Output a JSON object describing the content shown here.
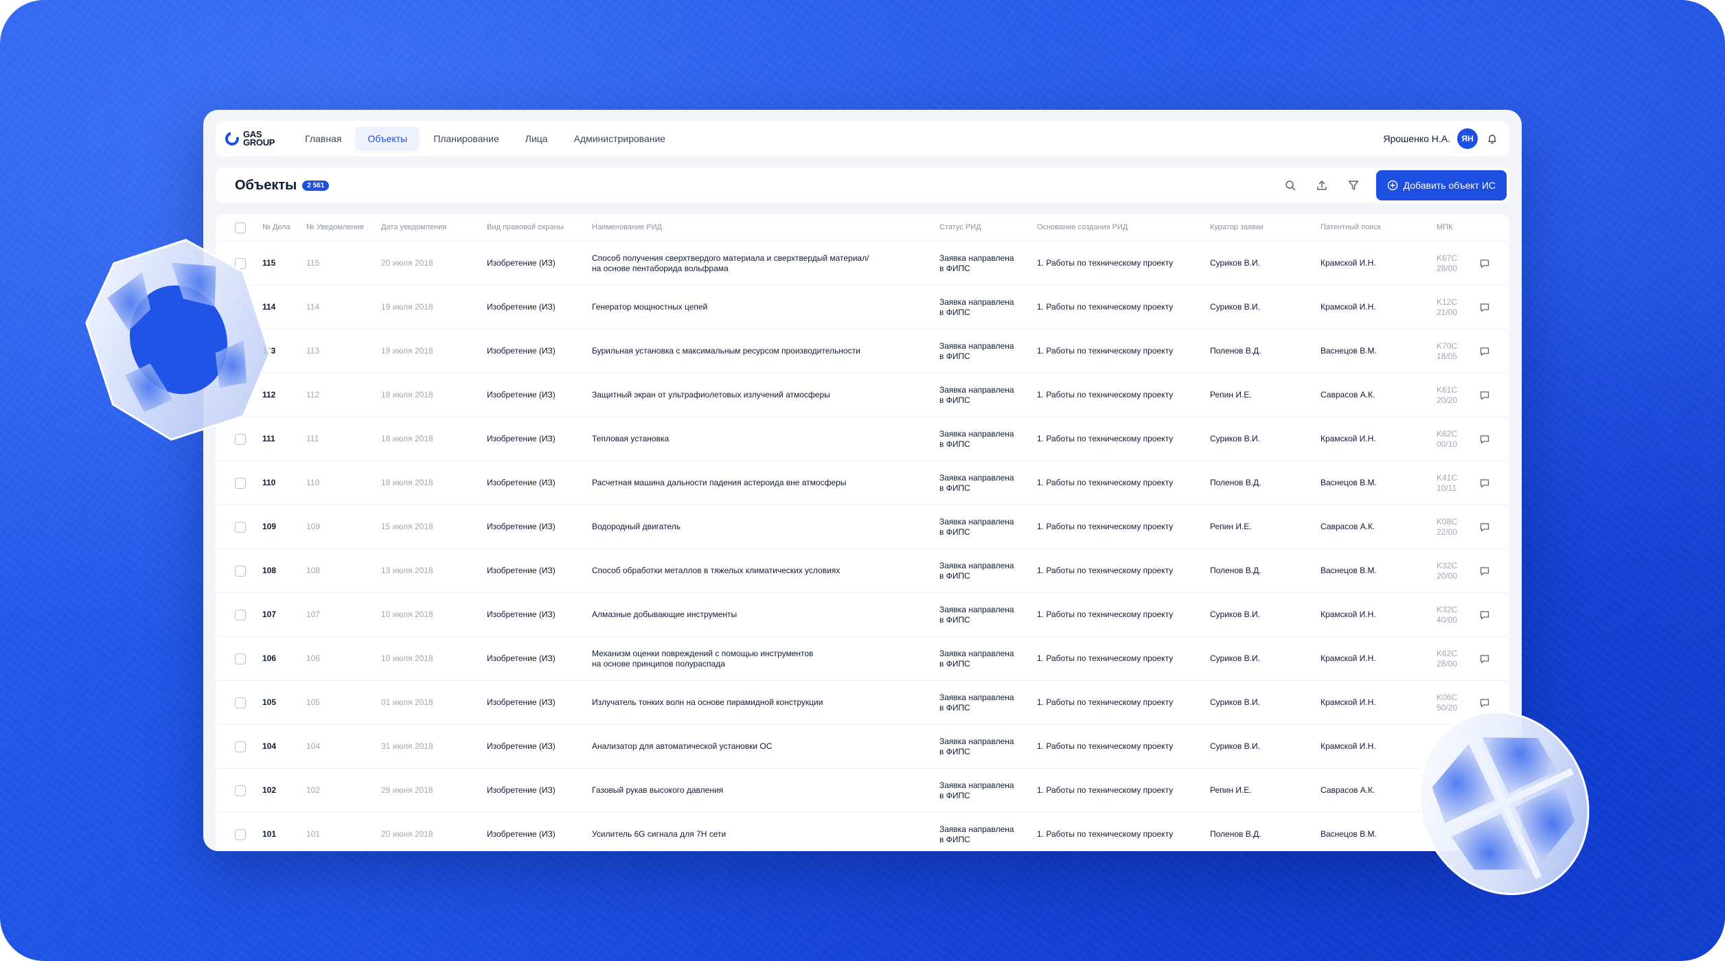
{
  "app": {
    "logo_line1": "GAS",
    "logo_line2": "GROUP"
  },
  "nav": {
    "tabs": [
      {
        "label": "Главная"
      },
      {
        "label": "Объекты"
      },
      {
        "label": "Планирование"
      },
      {
        "label": "Лица"
      },
      {
        "label": "Администрирование"
      }
    ],
    "active_tab": "Объекты",
    "user_name": "Ярошенко Н.А.",
    "avatar_initials": "ЯН",
    "bell_icon": "bell-icon"
  },
  "header": {
    "title": "Объекты",
    "count": "2 561",
    "add_button_label": "Добавить объект ИС",
    "icons": [
      "search-icon",
      "upload-icon",
      "filter-icon",
      "plus-circle-icon"
    ]
  },
  "table": {
    "columns": [
      "№ Дела",
      "№ Уведомления",
      "Дата уведомления",
      "Вид правовой охраны",
      "Наименование РИД",
      "Статус РИД",
      "Основание создания РИД",
      "Куратор заявки",
      "Патентный поиск",
      "МПК"
    ],
    "rows": [
      {
        "num": "115",
        "notif": "115",
        "date": "20 июля 2018",
        "type": "Изобретение (ИЗ)",
        "name1": "Способ получения сверхтвердого материала и сверхтвердый материал/",
        "name2": "на основе пентаборида вольфрама",
        "status1": "Заявка направлена",
        "status2": "в ФИПС",
        "basis": "1. Работы по техническому проекту",
        "curator": "Суриков В.И.",
        "patent": "Крамской И.Н.",
        "mpk1": "K67C",
        "mpk2": "28/00"
      },
      {
        "num": "114",
        "notif": "114",
        "date": "19 июля 2018",
        "type": "Изобретение (ИЗ)",
        "name1": "Генератор мощностных цепей",
        "name2": "",
        "status1": "Заявка направлена",
        "status2": "в ФИПС",
        "basis": "1. Работы по техническому проекту",
        "curator": "Суриков В.И.",
        "patent": "Крамской И.Н.",
        "mpk1": "K12C",
        "mpk2": "21/00"
      },
      {
        "num": "113",
        "notif": "113",
        "date": "19 июля 2018",
        "type": "Изобретение (ИЗ)",
        "name1": "Бурильная установка с максимальным ресурсом производительности",
        "name2": "",
        "status1": "Заявка направлена",
        "status2": "в ФИПС",
        "basis": "1. Работы по техническому проекту",
        "curator": "Поленов В.Д.",
        "patent": "Васнецов В.М.",
        "mpk1": "K70C",
        "mpk2": "18/05"
      },
      {
        "num": "112",
        "notif": "112",
        "date": "18 июля 2018",
        "type": "Изобретение (ИЗ)",
        "name1": "Защитный экран от ультрафиолетовых излучений атмосферы",
        "name2": "",
        "status1": "Заявка направлена",
        "status2": "в ФИПС",
        "basis": "1. Работы по техническому проекту",
        "curator": "Репин И.Е.",
        "patent": "Саврасов А.К.",
        "mpk1": "K61C",
        "mpk2": "20/20"
      },
      {
        "num": "111",
        "notif": "111",
        "date": "18 июля 2018",
        "type": "Изобретение (ИЗ)",
        "name1": "Тепловая установка",
        "name2": "",
        "status1": "Заявка направлена",
        "status2": "в ФИПС",
        "basis": "1. Работы по техническому проекту",
        "curator": "Суриков В.И.",
        "patent": "Крамской И.Н.",
        "mpk1": "K62C",
        "mpk2": "00/10"
      },
      {
        "num": "110",
        "notif": "110",
        "date": "18 июля 2018",
        "type": "Изобретение (ИЗ)",
        "name1": "Расчетная машина дальности падения астероида вне атмосферы",
        "name2": "",
        "status1": "Заявка направлена",
        "status2": "в ФИПС",
        "basis": "1. Работы по техническому проекту",
        "curator": "Поленов В.Д.",
        "patent": "Васнецов В.М.",
        "mpk1": "K41C",
        "mpk2": "10/11"
      },
      {
        "num": "109",
        "notif": "109",
        "date": "15 июля 2018",
        "type": "Изобретение (ИЗ)",
        "name1": "Водородный двигатель",
        "name2": "",
        "status1": "Заявка направлена",
        "status2": "в ФИПС",
        "basis": "1. Работы по техническому проекту",
        "curator": "Репин И.Е.",
        "patent": "Саврасов А.К.",
        "mpk1": "K08C",
        "mpk2": "22/00"
      },
      {
        "num": "108",
        "notif": "108",
        "date": "13 июля 2018",
        "type": "Изобретение (ИЗ)",
        "name1": "Способ обработки металлов в тяжелых климатических условиях",
        "name2": "",
        "status1": "Заявка направлена",
        "status2": "в ФИПС",
        "basis": "1. Работы по техническому проекту",
        "curator": "Поленов В.Д.",
        "patent": "Васнецов В.М.",
        "mpk1": "K32C",
        "mpk2": "20/00"
      },
      {
        "num": "107",
        "notif": "107",
        "date": "10 июля 2018",
        "type": "Изобретение (ИЗ)",
        "name1": "Алмазные добывающие инструменты",
        "name2": "",
        "status1": "Заявка направлена",
        "status2": "в ФИПС",
        "basis": "1. Работы по техническому проекту",
        "curator": "Суриков В.И.",
        "patent": "Крамской И.Н.",
        "mpk1": "K32C",
        "mpk2": "40/00"
      },
      {
        "num": "106",
        "notif": "106",
        "date": "10 июля 2018",
        "type": "Изобретение (ИЗ)",
        "name1": "Механизм оценки повреждений с помощью инструментов",
        "name2": "на основе принципов полураспада",
        "status1": "Заявка направлена",
        "status2": "в ФИПС",
        "basis": "1. Работы по техническому проекту",
        "curator": "Суриков В.И.",
        "patent": "Крамской И.Н.",
        "mpk1": "K62C",
        "mpk2": "28/00"
      },
      {
        "num": "105",
        "notif": "105",
        "date": "01 июля 2018",
        "type": "Изобретение (ИЗ)",
        "name1": "Излучатель тонких волн на основе пирамидной конструкции",
        "name2": "",
        "status1": "Заявка направлена",
        "status2": "в ФИПС",
        "basis": "1. Работы по техническому проекту",
        "curator": "Суриков В.И.",
        "patent": "Крамской И.Н.",
        "mpk1": "K06C",
        "mpk2": "50/20"
      },
      {
        "num": "104",
        "notif": "104",
        "date": "31 июля 2018",
        "type": "Изобретение (ИЗ)",
        "name1": "Анализатор для автоматической установки ОС",
        "name2": "",
        "status1": "Заявка направлена",
        "status2": "в ФИПС",
        "basis": "1. Работы по техническому проекту",
        "curator": "Суриков В.И.",
        "patent": "Крамской И.Н.",
        "mpk1": "",
        "mpk2": ""
      },
      {
        "num": "102",
        "notif": "102",
        "date": "29 июня 2018",
        "type": "Изобретение (ИЗ)",
        "name1": "Газовый рукав высокого давления",
        "name2": "",
        "status1": "Заявка направлена",
        "status2": "в ФИПС",
        "basis": "1. Работы по техническому проекту",
        "curator": "Репин И.Е.",
        "patent": "Саврасов А.К.",
        "mpk1": "",
        "mpk2": ""
      },
      {
        "num": "101",
        "notif": "101",
        "date": "20 июня 2018",
        "type": "Изобретение (ИЗ)",
        "name1": "Усилитель 6G сигнала для 7Н сети",
        "name2": "",
        "status1": "Заявка направлена",
        "status2": "в ФИПС",
        "basis": "1. Работы по техническому проекту",
        "curator": "Поленов В.Д.",
        "patent": "Васнецов В.М.",
        "mpk1": "",
        "mpk2": ""
      }
    ]
  },
  "colors": {
    "accent": "#1d4fe0",
    "background": "#1f54e6"
  }
}
